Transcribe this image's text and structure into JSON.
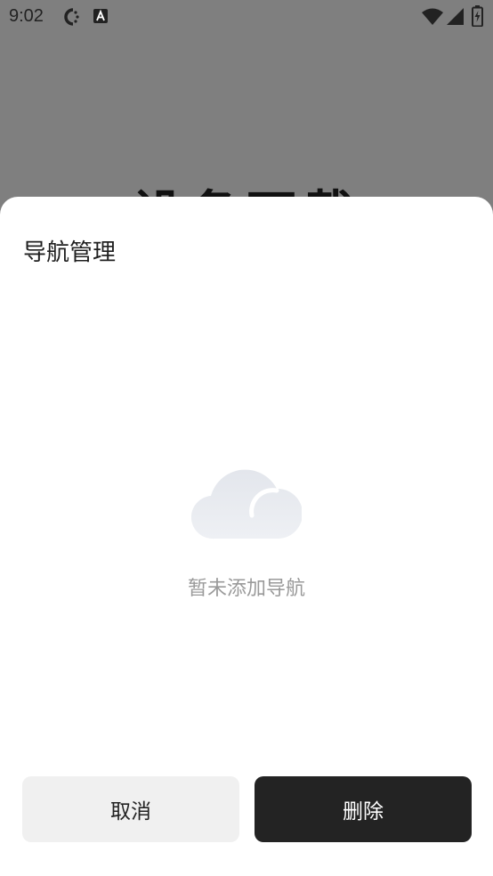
{
  "status_bar": {
    "time": "9:02",
    "icons": [
      "sync-icon",
      "accessibility-a-icon",
      "wifi-icon",
      "signal-icon",
      "battery-charging-icon"
    ]
  },
  "background": {
    "title_fragment": "设备下载"
  },
  "sheet": {
    "title": "导航管理",
    "empty_icon": "cloud-icon",
    "empty_text": "暂未添加导航",
    "cancel_label": "取消",
    "delete_label": "删除"
  },
  "colors": {
    "overlay": "#7f7f7f",
    "sheet": "#ffffff",
    "cancel_bg": "#f0f0f0",
    "delete_bg": "#232323",
    "empty_text": "#9a9a9a"
  }
}
